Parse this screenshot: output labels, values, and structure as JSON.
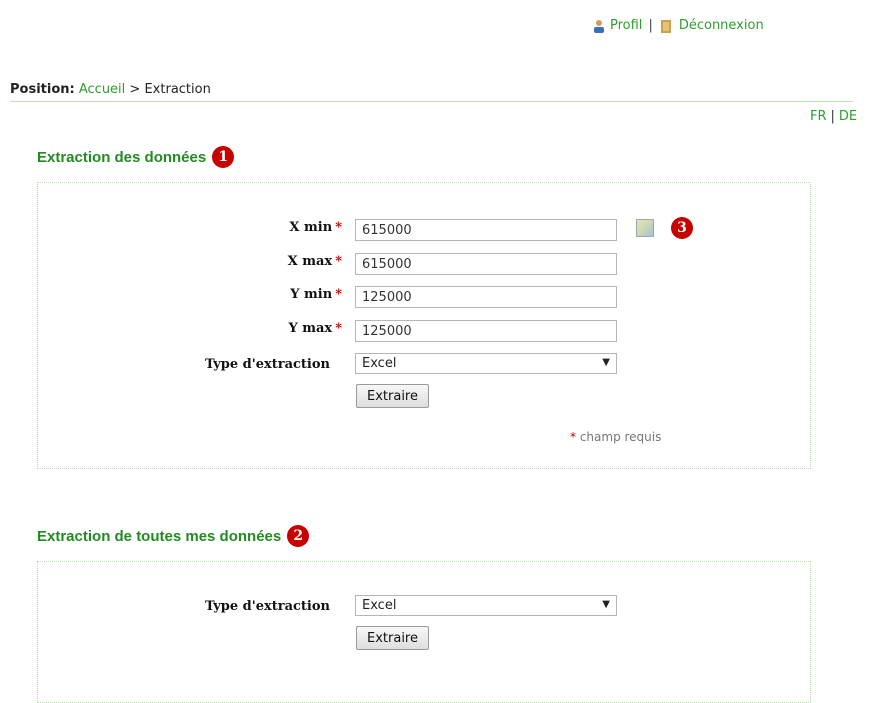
{
  "topbar": {
    "profil": "Profil",
    "separator": "|",
    "deconnexion": "Déconnexion"
  },
  "breadcrumb": {
    "label": "Position:",
    "home": "Accueil",
    "separator": ">",
    "current": "Extraction"
  },
  "lang": {
    "fr": "FR",
    "separator": "|",
    "de": "DE"
  },
  "section1": {
    "title": "Extraction des données",
    "badge": "1",
    "badge3": "3",
    "fields": {
      "xmin_label": "X min",
      "xmin_value": "615000",
      "xmax_label": "X max",
      "xmax_value": "615000",
      "ymin_label": "Y min",
      "ymin_value": "125000",
      "ymax_label": "Y max",
      "ymax_value": "125000",
      "required_star": "*"
    },
    "type_label": "Type d'extraction",
    "type_value": "Excel",
    "button": "Extraire",
    "required_note": "champ requis"
  },
  "section2": {
    "title": "Extraction de toutes mes données",
    "badge": "2",
    "type_label": "Type d'extraction",
    "type_value": "Excel",
    "button": "Extraire"
  }
}
